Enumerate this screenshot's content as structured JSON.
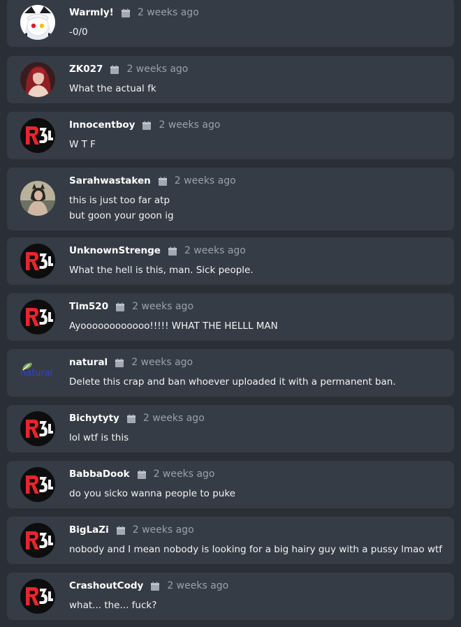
{
  "comments": [
    {
      "username": "Warmly!",
      "time": "2 weeks ago",
      "avatar": "anime-girl-avatar",
      "lines": [
        "-0/0"
      ]
    },
    {
      "username": "ZK027",
      "time": "2 weeks ago",
      "avatar": "red-hair-photo-avatar",
      "lines": [
        "What the actual fk"
      ]
    },
    {
      "username": "Innocentboy",
      "time": "2 weeks ago",
      "avatar": "r34-logo-avatar",
      "lines": [
        "W T F"
      ]
    },
    {
      "username": "Sarahwastaken",
      "time": "2 weeks ago",
      "avatar": "photo-avatar",
      "lines": [
        "this is just too far atp",
        "but goon your goon ig"
      ]
    },
    {
      "username": "UnknownStrenge",
      "time": "2 weeks ago",
      "avatar": "r34-logo-avatar",
      "lines": [
        "What the hell is this, man. Sick people."
      ]
    },
    {
      "username": "Tim520",
      "time": "2 weeks ago",
      "avatar": "r34-logo-avatar",
      "lines": [
        "Ayoooooooooooo!!!!! WHAT THE HELLL MAN"
      ]
    },
    {
      "username": "natural",
      "time": "2 weeks ago",
      "avatar": "broken-image-avatar",
      "avatar_alt": "natural",
      "lines": [
        "Delete this crap and ban whoever uploaded it with a permanent ban."
      ]
    },
    {
      "username": "Bichytyty",
      "time": "2 weeks ago",
      "avatar": "r34-logo-avatar",
      "lines": [
        "lol wtf is this"
      ]
    },
    {
      "username": "BabbaDook",
      "time": "2 weeks ago",
      "avatar": "r34-logo-avatar",
      "lines": [
        "do you sicko wanna people to puke"
      ]
    },
    {
      "username": "BigLaZi",
      "time": "2 weeks ago",
      "avatar": "r34-logo-avatar",
      "lines": [
        "nobody and I mean nobody is looking for a big hairy guy with a pussy lmao wtf"
      ]
    },
    {
      "username": "CrashoutCody",
      "time": "2 weeks ago",
      "avatar": "r34-logo-avatar",
      "lines": [
        "what... the... fuck?"
      ]
    }
  ],
  "colors": {
    "background": "#2a2f37",
    "card": "#363c45",
    "username": "#ffffff",
    "timestamp": "#9aa1ab",
    "text": "#f2f3f5",
    "r34_red": "#e5262d"
  },
  "icons": {
    "timestamp": "calendar-icon"
  }
}
